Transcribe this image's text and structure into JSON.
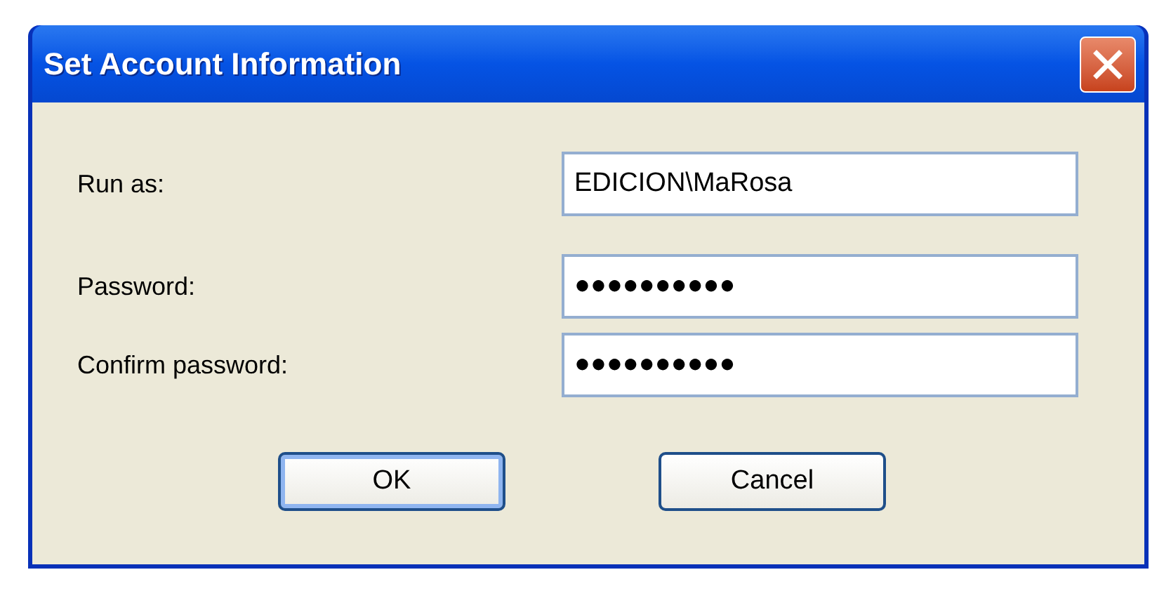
{
  "window": {
    "title": "Set Account Information"
  },
  "fields": [
    {
      "label": "Run as:",
      "value": "EDICION\\MaRosa"
    },
    {
      "label": "Password:",
      "value": "●●●●●●●●●●"
    },
    {
      "label": "Confirm password:",
      "value": "●●●●●●●●●●"
    }
  ],
  "buttons": [
    {
      "label": "OK",
      "default": true
    },
    {
      "label": "Cancel",
      "default": false
    }
  ]
}
